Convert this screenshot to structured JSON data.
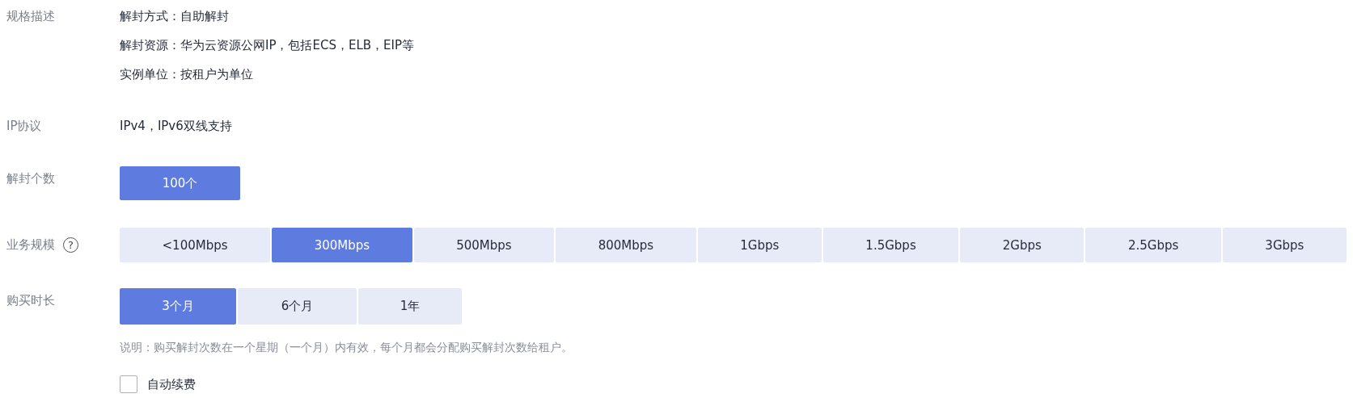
{
  "spec": {
    "label": "规格描述",
    "lines": [
      "解封方式：自助解封",
      "解封资源：华为云资源公网IP，包括ECS，ELB，EIP等",
      "实例单位：按租户为单位"
    ]
  },
  "ip_protocol": {
    "label": "IP协议",
    "value": "IPv4，IPv6双线支持"
  },
  "unblock_count": {
    "label": "解封个数",
    "options": [
      {
        "label": "100个",
        "selected": true
      }
    ]
  },
  "business_scale": {
    "label": "业务规模",
    "help_icon": "?",
    "options": [
      {
        "label": "<100Mbps",
        "selected": false
      },
      {
        "label": "300Mbps",
        "selected": true
      },
      {
        "label": "500Mbps",
        "selected": false
      },
      {
        "label": "800Mbps",
        "selected": false
      },
      {
        "label": "1Gbps",
        "selected": false
      },
      {
        "label": "1.5Gbps",
        "selected": false
      },
      {
        "label": "2Gbps",
        "selected": false
      },
      {
        "label": "2.5Gbps",
        "selected": false
      },
      {
        "label": "3Gbps",
        "selected": false
      }
    ]
  },
  "duration": {
    "label": "购买时长",
    "options": [
      {
        "label": "3个月",
        "selected": true
      },
      {
        "label": "6个月",
        "selected": false
      },
      {
        "label": "1年",
        "selected": false
      }
    ],
    "note": "说明：购买解封次数在一个星期（一个月）内有效，每个月都会分配购买解封次数给租户。",
    "auto_renew": {
      "label": "自动续费",
      "checked": false
    }
  }
}
